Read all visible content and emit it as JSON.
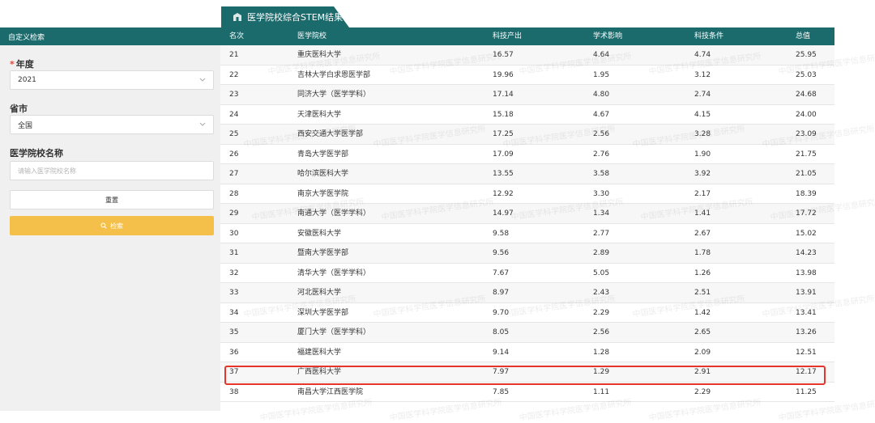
{
  "tab": {
    "title": "医学院校综合STEM结果",
    "icon": "school-icon"
  },
  "filters": {
    "header": "自定义检索",
    "year": {
      "label": "年度",
      "value": "2021"
    },
    "province": {
      "label": "省市",
      "value": "全国"
    },
    "school": {
      "label": "医学院校名称",
      "placeholder": "请输入医学院校名称"
    },
    "reset_label": "重置",
    "search_label": "检索"
  },
  "table": {
    "headers": [
      "名次",
      "医学院校",
      "科技产出",
      "学术影响",
      "科技条件",
      "总值"
    ],
    "rows": [
      [
        "21",
        "重庆医科大学",
        "16.57",
        "4.64",
        "4.74",
        "25.95"
      ],
      [
        "22",
        "吉林大学白求恩医学部",
        "19.96",
        "1.95",
        "3.12",
        "25.03"
      ],
      [
        "23",
        "同济大学（医学学科）",
        "17.14",
        "4.80",
        "2.74",
        "24.68"
      ],
      [
        "24",
        "天津医科大学",
        "15.18",
        "4.67",
        "4.15",
        "24.00"
      ],
      [
        "25",
        "西安交通大学医学部",
        "17.25",
        "2.56",
        "3.28",
        "23.09"
      ],
      [
        "26",
        "青岛大学医学部",
        "17.09",
        "2.76",
        "1.90",
        "21.75"
      ],
      [
        "27",
        "哈尔滨医科大学",
        "13.55",
        "3.58",
        "3.92",
        "21.05"
      ],
      [
        "28",
        "南京大学医学院",
        "12.92",
        "3.30",
        "2.17",
        "18.39"
      ],
      [
        "29",
        "南通大学（医学学科）",
        "14.97",
        "1.34",
        "1.41",
        "17.72"
      ],
      [
        "30",
        "安徽医科大学",
        "9.58",
        "2.77",
        "2.67",
        "15.02"
      ],
      [
        "31",
        "暨南大学医学部",
        "9.56",
        "2.89",
        "1.78",
        "14.23"
      ],
      [
        "32",
        "清华大学（医学学科）",
        "7.67",
        "5.05",
        "1.26",
        "13.98"
      ],
      [
        "33",
        "河北医科大学",
        "8.97",
        "2.43",
        "2.51",
        "13.91"
      ],
      [
        "34",
        "深圳大学医学部",
        "9.70",
        "2.29",
        "1.42",
        "13.41"
      ],
      [
        "35",
        "厦门大学（医学学科）",
        "8.05",
        "2.56",
        "2.65",
        "13.26"
      ],
      [
        "36",
        "福建医科大学",
        "9.14",
        "1.28",
        "2.09",
        "12.51"
      ],
      [
        "37",
        "广西医科大学",
        "7.97",
        "1.29",
        "2.91",
        "12.17"
      ],
      [
        "38",
        "南昌大学江西医学院",
        "7.85",
        "1.11",
        "2.29",
        "11.25"
      ]
    ],
    "highlighted_rank": "37"
  },
  "watermark": "中国医学科学院医学信息研究所",
  "colors": {
    "header": "#1b6b6d",
    "search_button": "#f5c04a",
    "highlight": "#e8352c"
  }
}
